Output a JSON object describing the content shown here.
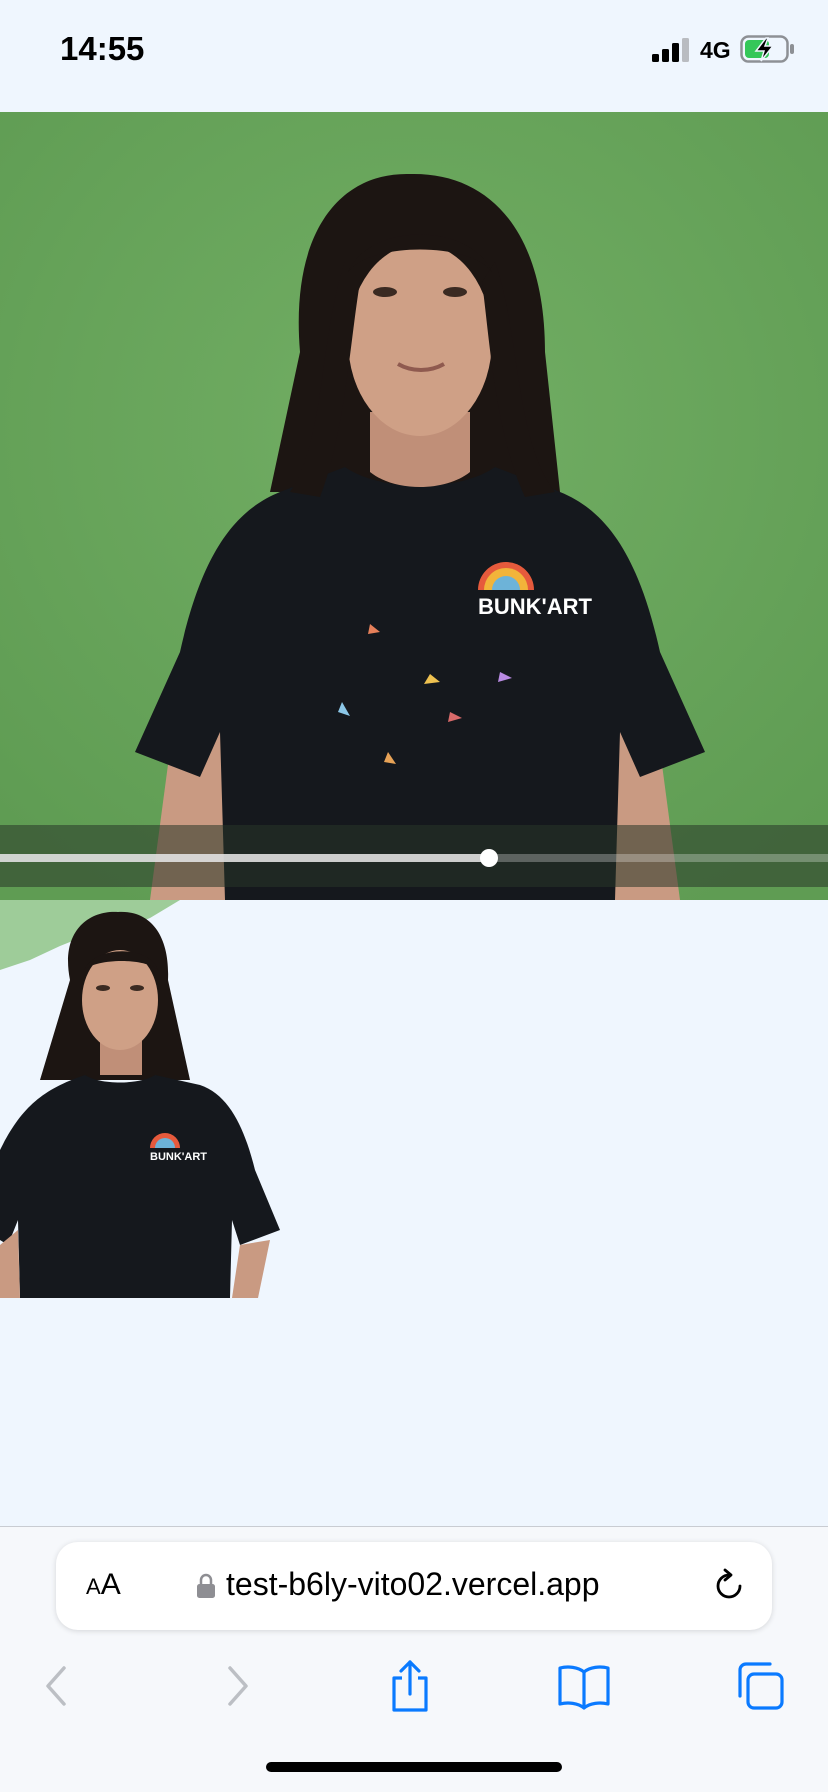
{
  "status_bar": {
    "time": "14:55",
    "network": "4G",
    "battery_state": "charging",
    "signal_bars": 3
  },
  "video": {
    "background_color": "#69a85c",
    "shirt_logo_text": "BUNK'ART",
    "playback_progress": 0.59
  },
  "output": {
    "shirt_logo_text": "BUNK'ART"
  },
  "browser": {
    "text_size_label_small": "A",
    "text_size_label_large": "A",
    "url": "test-b6ly-vito02.vercel.app",
    "accent_color": "#0a7aff"
  },
  "icons": {
    "back": "chevron-left-icon",
    "forward": "chevron-right-icon",
    "share": "share-icon",
    "bookmarks": "book-icon",
    "tabs": "tabs-icon",
    "reload": "reload-icon",
    "lock": "lock-icon"
  }
}
